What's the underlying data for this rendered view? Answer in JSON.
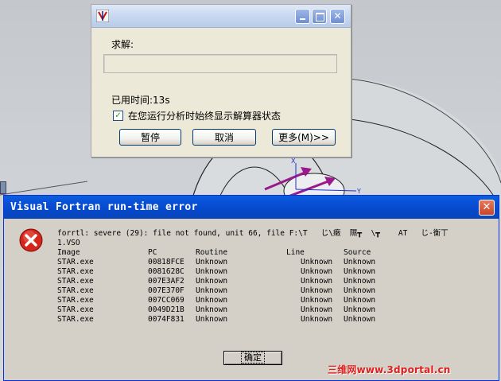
{
  "solver_dialog": {
    "label_solve": "求解:",
    "elapsed_label": "已用时间:13s",
    "checkbox_label": "在您运行分析时始终显示解算器状态",
    "checkbox_checked": true,
    "pause_button": "暂停",
    "cancel_button": "取消",
    "more_button": "更多(M)>>"
  },
  "error_dialog": {
    "title": "Visual Fortran run-time error",
    "message_line1": "forrtl: severe (29): file not found, unit 66, file F:\\T   じ\\瘷  隰┳  \\┳    AT   じ-衡丅",
    "message_line2": "1.VSO",
    "columns": [
      "Image",
      "PC",
      "Routine",
      "Line",
      "Source"
    ],
    "rows": [
      [
        "STAR.exe",
        "00818FCE",
        "Unknown",
        "Unknown",
        "Unknown"
      ],
      [
        "STAR.exe",
        "0081628C",
        "Unknown",
        "Unknown",
        "Unknown"
      ],
      [
        "STAR.exe",
        "007E3AF2",
        "Unknown",
        "Unknown",
        "Unknown"
      ],
      [
        "STAR.exe",
        "007E370F",
        "Unknown",
        "Unknown",
        "Unknown"
      ],
      [
        "STAR.exe",
        "007CC069",
        "Unknown",
        "Unknown",
        "Unknown"
      ],
      [
        "STAR.exe",
        "0049D21B",
        "Unknown",
        "Unknown",
        "Unknown"
      ],
      [
        "STAR.exe",
        "0074F831",
        "Unknown",
        "Unknown",
        "Unknown"
      ]
    ],
    "ok_button": "确定",
    "close_symbol": "✕"
  },
  "viewport": {
    "axis_x": "X",
    "axis_y": "Y"
  },
  "watermark": "三维网www.3dportal.cn",
  "colors": {
    "xp_title_blue": "#0a50d6",
    "dialog_bg": "#ece9d8",
    "error_bg": "#d4d0c8",
    "close_red": "#c8452b",
    "arrow_magenta": "#9a1a8c",
    "watermark_red": "#e0201e"
  }
}
